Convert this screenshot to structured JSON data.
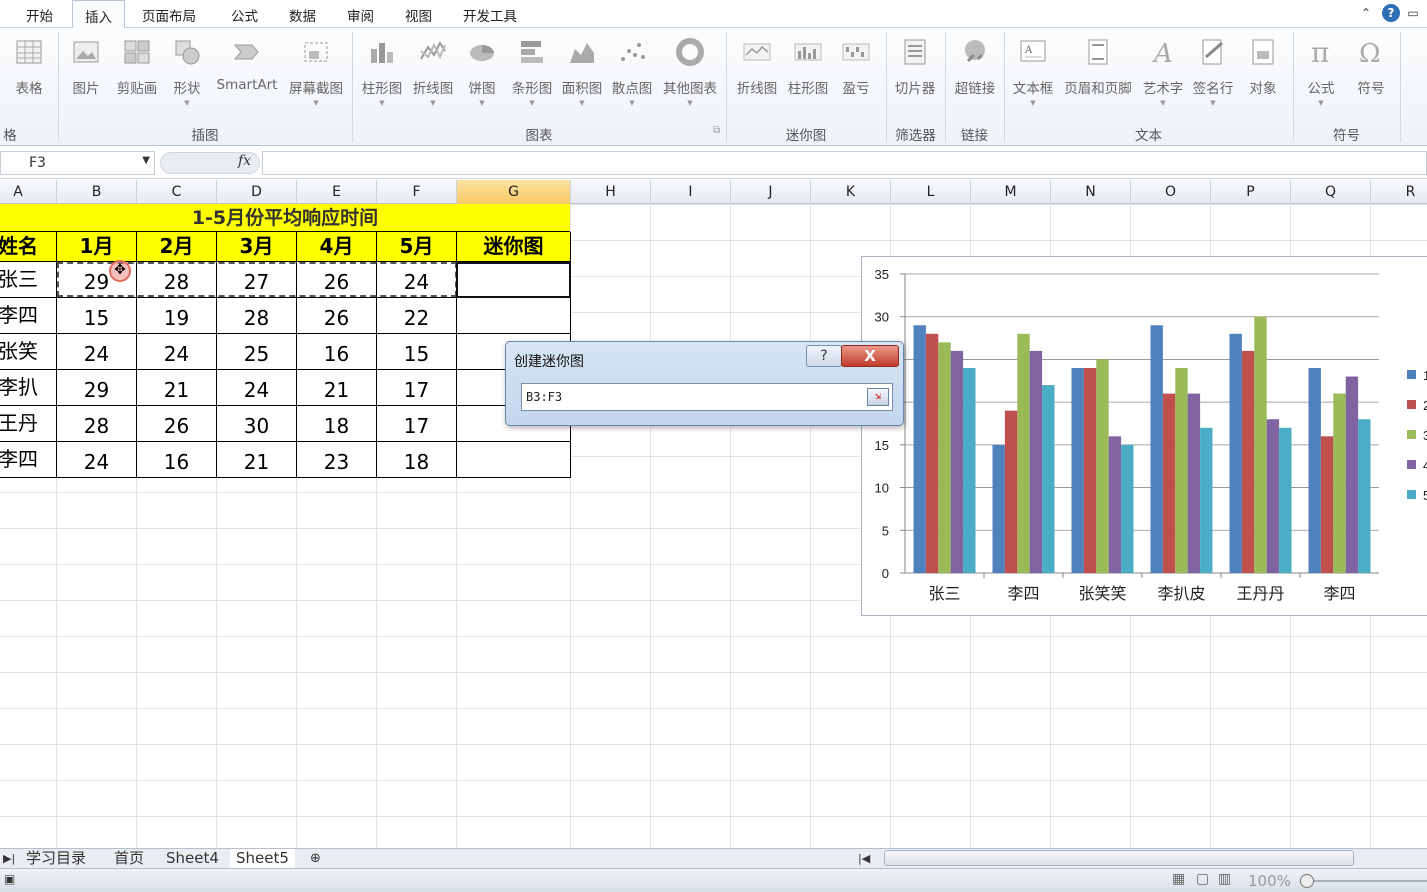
{
  "tabs": [
    "开始",
    "插入",
    "页面布局",
    "公式",
    "数据",
    "审阅",
    "视图",
    "开发工具"
  ],
  "active_tab": "插入",
  "ribbon_buttons": [
    {
      "label": "表格",
      "icon": "table-icon"
    },
    {
      "label": "图片",
      "icon": "picture-icon"
    },
    {
      "label": "剪贴画",
      "icon": "clipart-icon"
    },
    {
      "label": "形状",
      "icon": "shapes-icon"
    },
    {
      "label": "SmartArt",
      "icon": "smartart-icon"
    },
    {
      "label": "屏幕截图",
      "icon": "screenshot-icon"
    },
    {
      "label": "柱形图",
      "icon": "column-chart-icon"
    },
    {
      "label": "折线图",
      "icon": "line-chart-icon"
    },
    {
      "label": "饼图",
      "icon": "pie-chart-icon"
    },
    {
      "label": "条形图",
      "icon": "bar-chart-icon"
    },
    {
      "label": "面积图",
      "icon": "area-chart-icon"
    },
    {
      "label": "散点图",
      "icon": "scatter-chart-icon"
    },
    {
      "label": "其他图表",
      "icon": "other-chart-icon"
    },
    {
      "label": "折线图",
      "icon": "sparkline-line-icon"
    },
    {
      "label": "柱形图",
      "icon": "sparkline-column-icon"
    },
    {
      "label": "盈亏",
      "icon": "sparkline-winloss-icon"
    },
    {
      "label": "切片器",
      "icon": "slicer-icon"
    },
    {
      "label": "超链接",
      "icon": "hyperlink-icon"
    },
    {
      "label": "文本框",
      "icon": "textbox-icon"
    },
    {
      "label": "页眉和页脚",
      "icon": "header-footer-icon"
    },
    {
      "label": "艺术字",
      "icon": "wordart-icon"
    },
    {
      "label": "签名行",
      "icon": "signature-icon"
    },
    {
      "label": "对象",
      "icon": "object-icon"
    },
    {
      "label": "公式",
      "icon": "equation-icon"
    },
    {
      "label": "符号",
      "icon": "symbol-icon"
    }
  ],
  "ribbon_groups": [
    "格",
    "插图",
    "图表",
    "迷你图",
    "筛选器",
    "链接",
    "文本",
    "符号"
  ],
  "formula_bar": {
    "name_box": "F3",
    "fx": "fx",
    "formula": ""
  },
  "columns": [
    "A",
    "B",
    "C",
    "D",
    "E",
    "F",
    "G",
    "H",
    "I",
    "J",
    "K",
    "L",
    "M",
    "N",
    "O",
    "P",
    "Q",
    "R"
  ],
  "table": {
    "title": "1-5月份平均响应时间",
    "headers": [
      "姓名",
      "1月",
      "2月",
      "3月",
      "4月",
      "5月",
      "迷你图"
    ],
    "rows": [
      [
        "张三",
        "29",
        "28",
        "27",
        "26",
        "24",
        ""
      ],
      [
        "李四",
        "15",
        "19",
        "28",
        "26",
        "22",
        ""
      ],
      [
        "张笑笑",
        "24",
        "24",
        "25",
        "16",
        "15",
        ""
      ],
      [
        "李扒皮",
        "29",
        "21",
        "24",
        "21",
        "17",
        ""
      ],
      [
        "王丹丹",
        "28",
        "26",
        "30",
        "18",
        "17",
        ""
      ],
      [
        "李四",
        "24",
        "16",
        "21",
        "23",
        "18",
        ""
      ]
    ]
  },
  "dialog": {
    "title": "创建迷你图",
    "help": "?",
    "close": "X",
    "range": "B3:F3"
  },
  "sheets": [
    "学习目录",
    "首页",
    "Sheet4",
    "Sheet5"
  ],
  "active_sheet": "Sheet5",
  "status": {
    "zoom": "100%"
  },
  "chart_data": {
    "type": "bar",
    "categories": [
      "张三",
      "李四",
      "张笑笑",
      "李扒皮",
      "王丹丹",
      "李四"
    ],
    "series": [
      {
        "name": "1",
        "values": [
          29,
          15,
          24,
          29,
          28,
          24
        ],
        "color": "#4f81bd"
      },
      {
        "name": "2",
        "values": [
          28,
          19,
          24,
          21,
          26,
          16
        ],
        "color": "#c0504d"
      },
      {
        "name": "3",
        "values": [
          27,
          28,
          25,
          24,
          30,
          21
        ],
        "color": "#9bbb59"
      },
      {
        "name": "4",
        "values": [
          26,
          26,
          16,
          21,
          18,
          23
        ],
        "color": "#8064a2"
      },
      {
        "name": "5",
        "values": [
          24,
          22,
          15,
          17,
          17,
          18
        ],
        "color": "#4bacc6"
      }
    ],
    "yticks": [
      "0",
      "5",
      "10",
      "15",
      "20",
      "25",
      "30",
      "35"
    ],
    "ylim": [
      0,
      35
    ],
    "grid": true,
    "legend": "right"
  }
}
